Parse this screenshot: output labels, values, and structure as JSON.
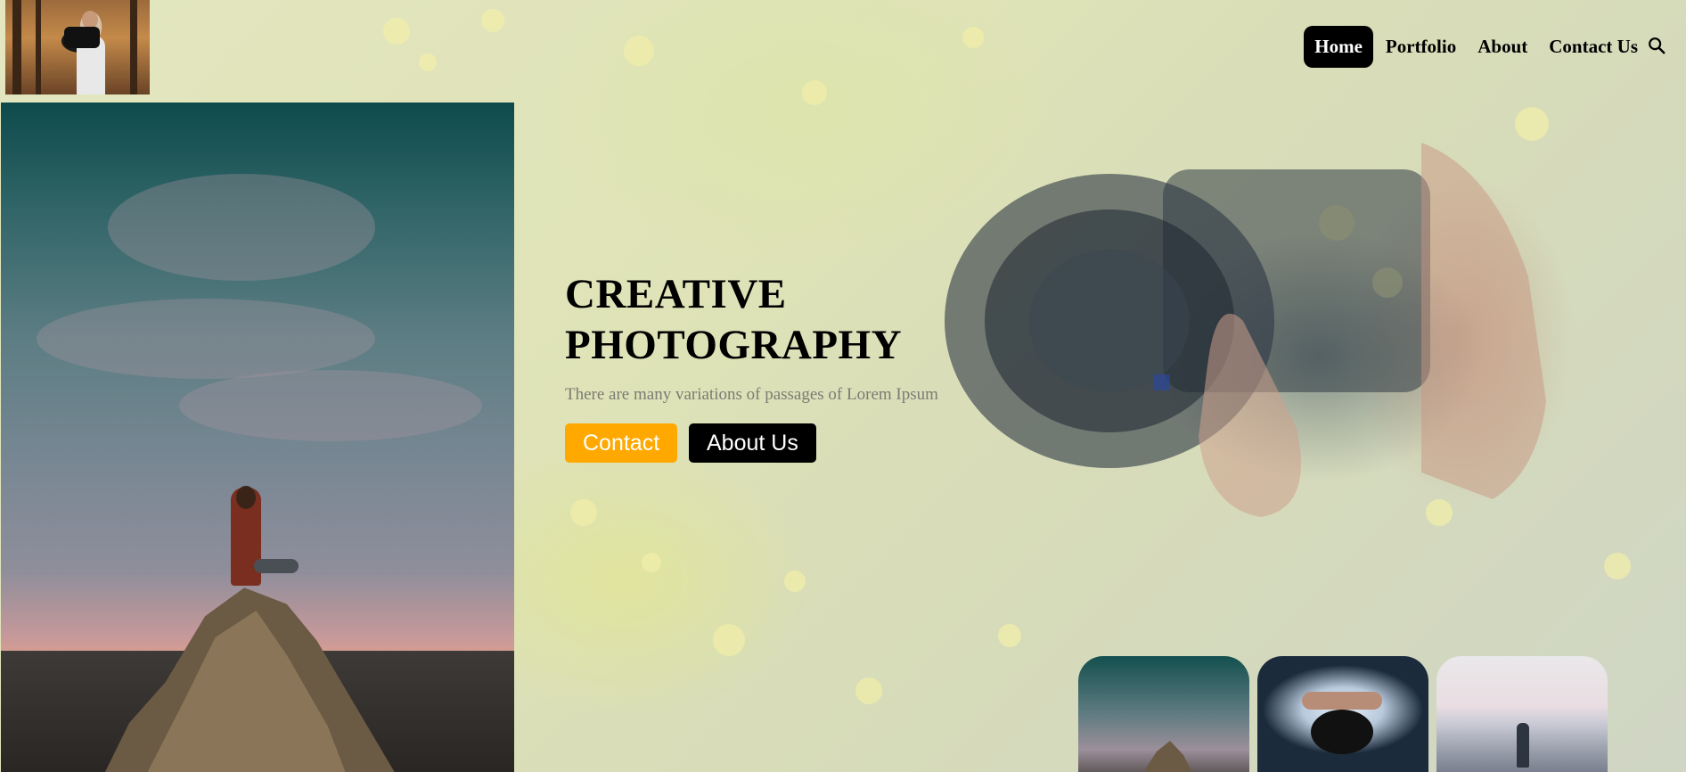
{
  "nav": {
    "items": [
      {
        "label": "Home",
        "active": true
      },
      {
        "label": "Portfolio",
        "active": false
      },
      {
        "label": "About",
        "active": false
      },
      {
        "label": "Contact Us",
        "active": false
      }
    ],
    "search_icon": "search-icon"
  },
  "hero": {
    "title_line1": "CREATIVE",
    "title_line2": "PHOTOGRAPHY",
    "subtitle": "There are many variations of passages of Lorem Ipsum",
    "contact_label": "Contact",
    "about_label": "About Us"
  },
  "colors": {
    "accent": "#ffa900",
    "dark": "#000000",
    "subtitle_text": "#7b7b74"
  }
}
